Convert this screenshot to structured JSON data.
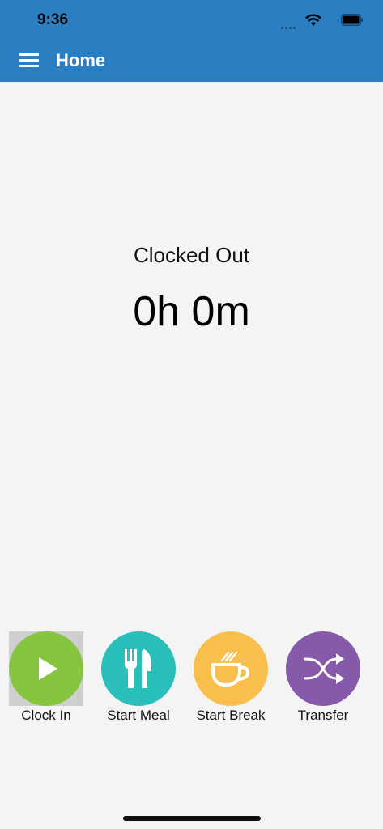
{
  "status_bar": {
    "time": "9:36",
    "icons": [
      "signal-icon",
      "wifi-icon",
      "battery-icon"
    ]
  },
  "header": {
    "title": "Home",
    "menu_icon": "hamburger-menu-icon",
    "background_color": "#2a7ec1"
  },
  "main": {
    "status_text": "Clocked Out",
    "elapsed_time": "0h 0m"
  },
  "actions": [
    {
      "label": "Clock In",
      "icon": "play-icon",
      "color": "#86c540"
    },
    {
      "label": "Start Meal",
      "icon": "fork-knife-icon",
      "color": "#2bbfbc"
    },
    {
      "label": "Start Break",
      "icon": "coffee-cup-icon",
      "color": "#f8bf4d"
    },
    {
      "label": "Transfer",
      "icon": "shuffle-icon",
      "color": "#8659a9"
    }
  ]
}
